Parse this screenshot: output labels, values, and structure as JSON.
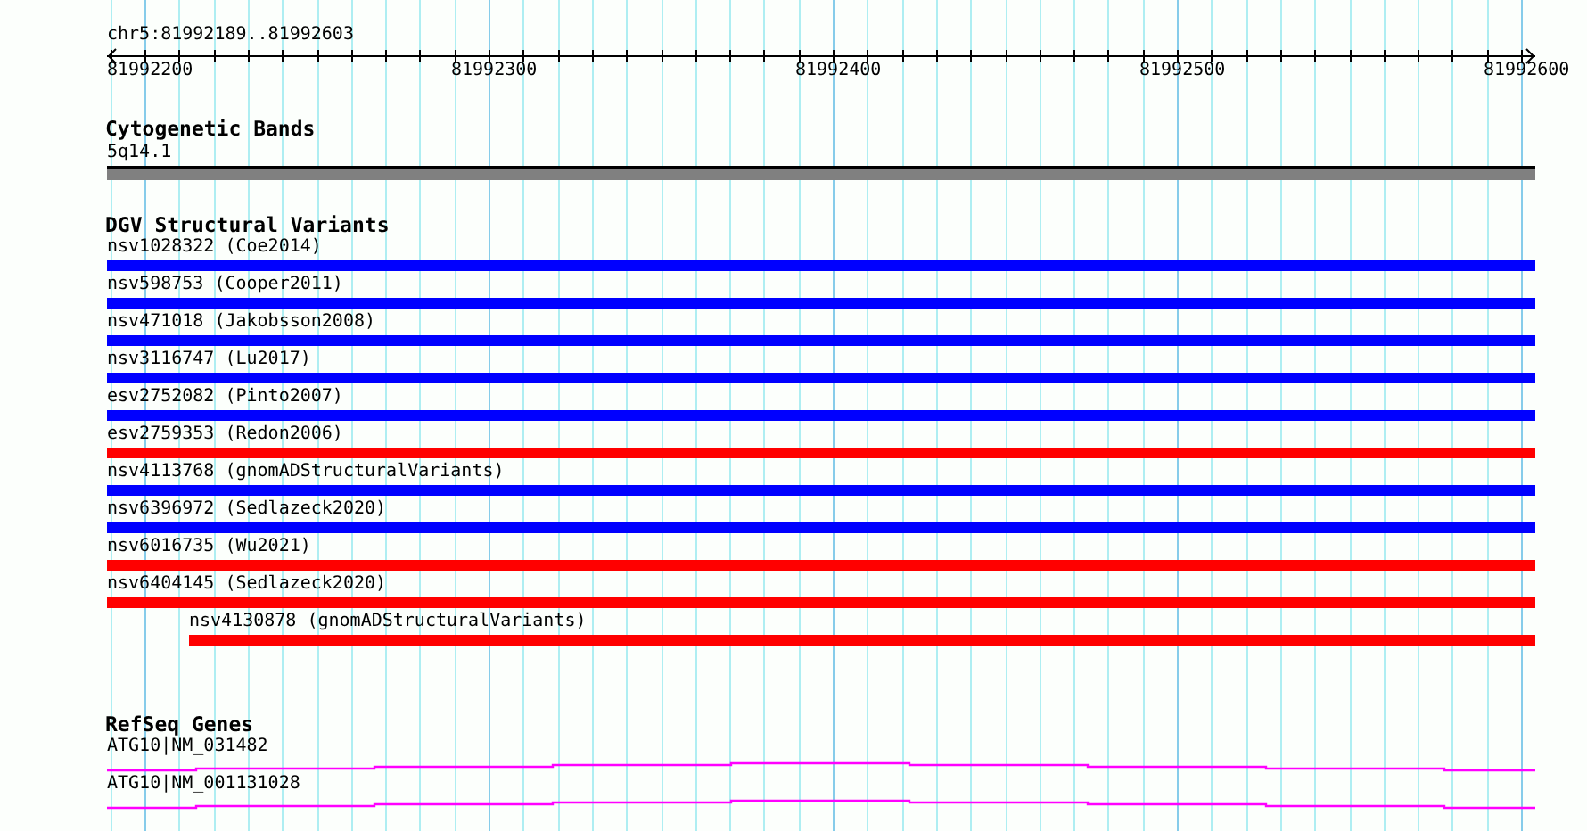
{
  "region": {
    "label": "chr5:81992189..81992603"
  },
  "ruler": {
    "ticks": [
      "81992200",
      "81992300",
      "81992400",
      "81992500",
      "81992600"
    ]
  },
  "tracks": [
    {
      "kind": "bands",
      "title": "Cytogenetic Bands",
      "features": [
        {
          "label": "5q14.1",
          "kind": "spanning",
          "color": "#808080"
        }
      ]
    },
    {
      "kind": "variants",
      "title": "DGV Structural Variants",
      "features": [
        {
          "label": "nsv1028322 (Coe2014)",
          "kind": "spanning",
          "color": "#0000ff"
        },
        {
          "label": "nsv598753 (Cooper2011)",
          "kind": "spanning",
          "color": "#0000ff"
        },
        {
          "label": "nsv471018 (Jakobsson2008)",
          "kind": "spanning",
          "color": "#0000ff"
        },
        {
          "label": "nsv3116747 (Lu2017)",
          "kind": "spanning",
          "color": "#0000ff"
        },
        {
          "label": "esv2752082 (Pinto2007)",
          "kind": "spanning",
          "color": "#0000ff"
        },
        {
          "label": "esv2759353 (Redon2006)",
          "kind": "spanning",
          "color": "#ff0000"
        },
        {
          "label": "nsv4113768 (gnomADStructuralVariants)",
          "kind": "spanning",
          "color": "#0000ff"
        },
        {
          "label": "nsv6396972 (Sedlazeck2020)",
          "kind": "spanning",
          "color": "#0000ff"
        },
        {
          "label": "nsv6016735 (Wu2021)",
          "kind": "spanning",
          "color": "#ff0000"
        },
        {
          "label": "nsv6404145 (Sedlazeck2020)",
          "kind": "spanning",
          "color": "#ff0000"
        },
        {
          "label": "nsv4130878 (gnomADStructuralVariants)",
          "kind": "starts_in_view",
          "color": "#ff0000"
        }
      ]
    },
    {
      "kind": "genes",
      "title": "RefSeq Genes",
      "features": [
        {
          "label": "ATG10|NM_031482",
          "color": "#ff00ff"
        },
        {
          "label": "ATG10|NM_001131028",
          "color": "#ff00ff"
        }
      ]
    }
  ]
}
